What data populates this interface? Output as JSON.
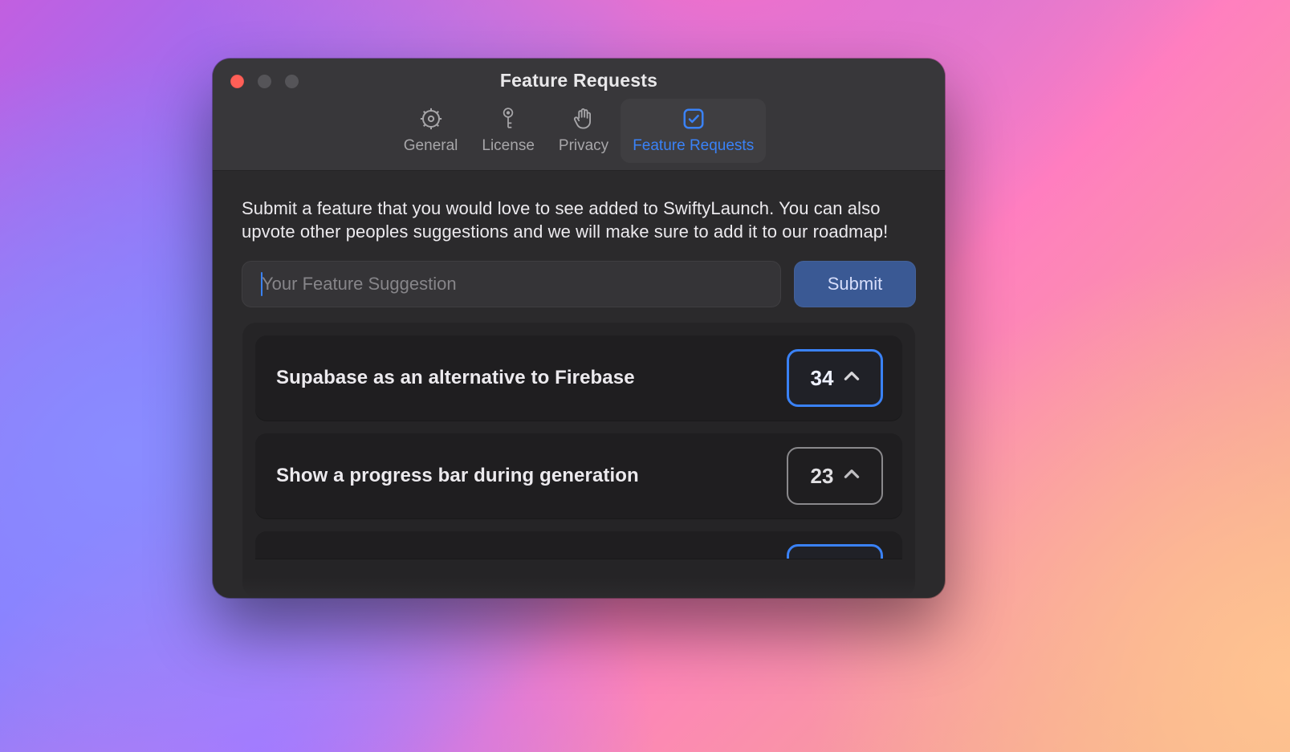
{
  "window": {
    "title": "Feature Requests"
  },
  "tabs": {
    "general": "General",
    "license": "License",
    "privacy": "Privacy",
    "feature": "Feature Requests"
  },
  "intro": "Submit a feature that you would love to see added to SwiftyLaunch. You can also upvote other peoples suggestions and we will make sure to add it to our roadmap!",
  "input": {
    "placeholder": "Your Feature Suggestion",
    "value": ""
  },
  "submit_label": "Submit",
  "requests": [
    {
      "title": "Supabase as an alternative to Firebase",
      "votes": "34",
      "voted": true
    },
    {
      "title": "Show a progress bar during generation",
      "votes": "23",
      "voted": false
    }
  ]
}
